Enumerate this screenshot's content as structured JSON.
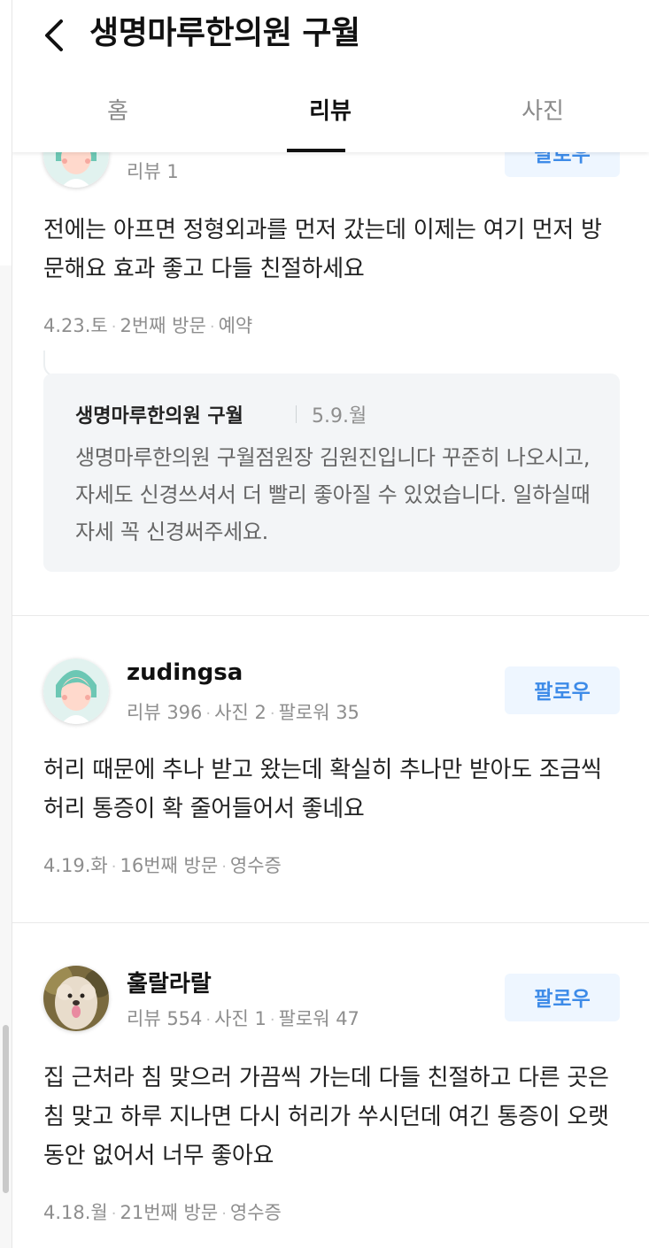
{
  "header": {
    "title": "생명마루한의원 구월",
    "tabs": [
      {
        "label": "홈",
        "active": false
      },
      {
        "label": "리뷰",
        "active": true
      },
      {
        "label": "사진",
        "active": false
      }
    ]
  },
  "reviews": [
    {
      "username": "",
      "stats": [
        "리뷰 1"
      ],
      "follow_label": "팔로우",
      "text": "전에는 아프면 정형외과를 먼저 갔는데 이제는 여기 먼저 방문해요 효과 좋고 다들 친절하세요",
      "meta": [
        "4.23.토",
        "2번째 방문",
        "예약"
      ],
      "reply": {
        "name": "생명마루한의원 구월",
        "date": "5.9.월",
        "text": "생명마루한의원 구월점원장 김원진입니다 꾸준히 나오시고, 자세도 신경쓰셔서 더 빨리 좋아질 수 있었습니다. 일하실때 자세 꼭 신경써주세요."
      }
    },
    {
      "username": "zudingsa",
      "stats": [
        "리뷰 396",
        "사진 2",
        "팔로워 35"
      ],
      "follow_label": "팔로우",
      "text": "허리 때문에 추나 받고 왔는데 확실히 추나만 받아도 조금씩 허리 통증이 확 줄어들어서 좋네요",
      "meta": [
        "4.19.화",
        "16번째 방문",
        "영수증"
      ]
    },
    {
      "username": "훌랄라랄",
      "stats": [
        "리뷰 554",
        "사진 1",
        "팔로워 47"
      ],
      "follow_label": "팔로우",
      "text": "집 근처라 침 맞으러 가끔씩 가는데 다들 친절하고 다른 곳은 침 맞고 하루 지나면 다시 허리가 쑤시던데 여긴 통증이 오랫동안 없어서 너무 좋아요",
      "meta": [
        "4.18.월",
        "21번째 방문",
        "영수증"
      ]
    }
  ],
  "colors": {
    "follow_bg": "#eef6ff",
    "follow_text": "#3d8be8",
    "reply_bg": "#f3f5f7",
    "muted_text": "#8e8e8e"
  }
}
